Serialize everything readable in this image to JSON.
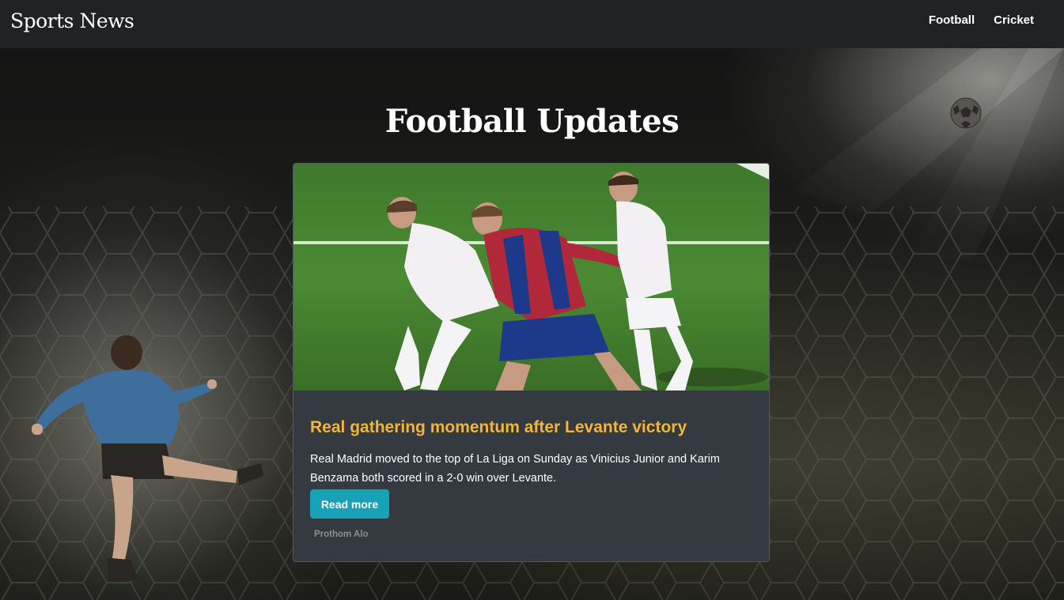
{
  "navbar": {
    "brand": "Sports News",
    "links": [
      {
        "label": "Football"
      },
      {
        "label": "Cricket"
      }
    ]
  },
  "page": {
    "title": "Football Updates"
  },
  "card": {
    "title": "Real gathering momentum after Levante victory",
    "text": "Real Madrid moved to the top of La Liga on Sunday as Vinicius Junior and Karim Benzama both scored in a 2-0 win over Levante.",
    "button_label": "Read more",
    "source": "Prothom Alo"
  },
  "colors": {
    "navbar_bg": "#212224",
    "card_bg": "#343a40",
    "card_title": "#f0b53a",
    "button_bg": "#17a2b8"
  }
}
